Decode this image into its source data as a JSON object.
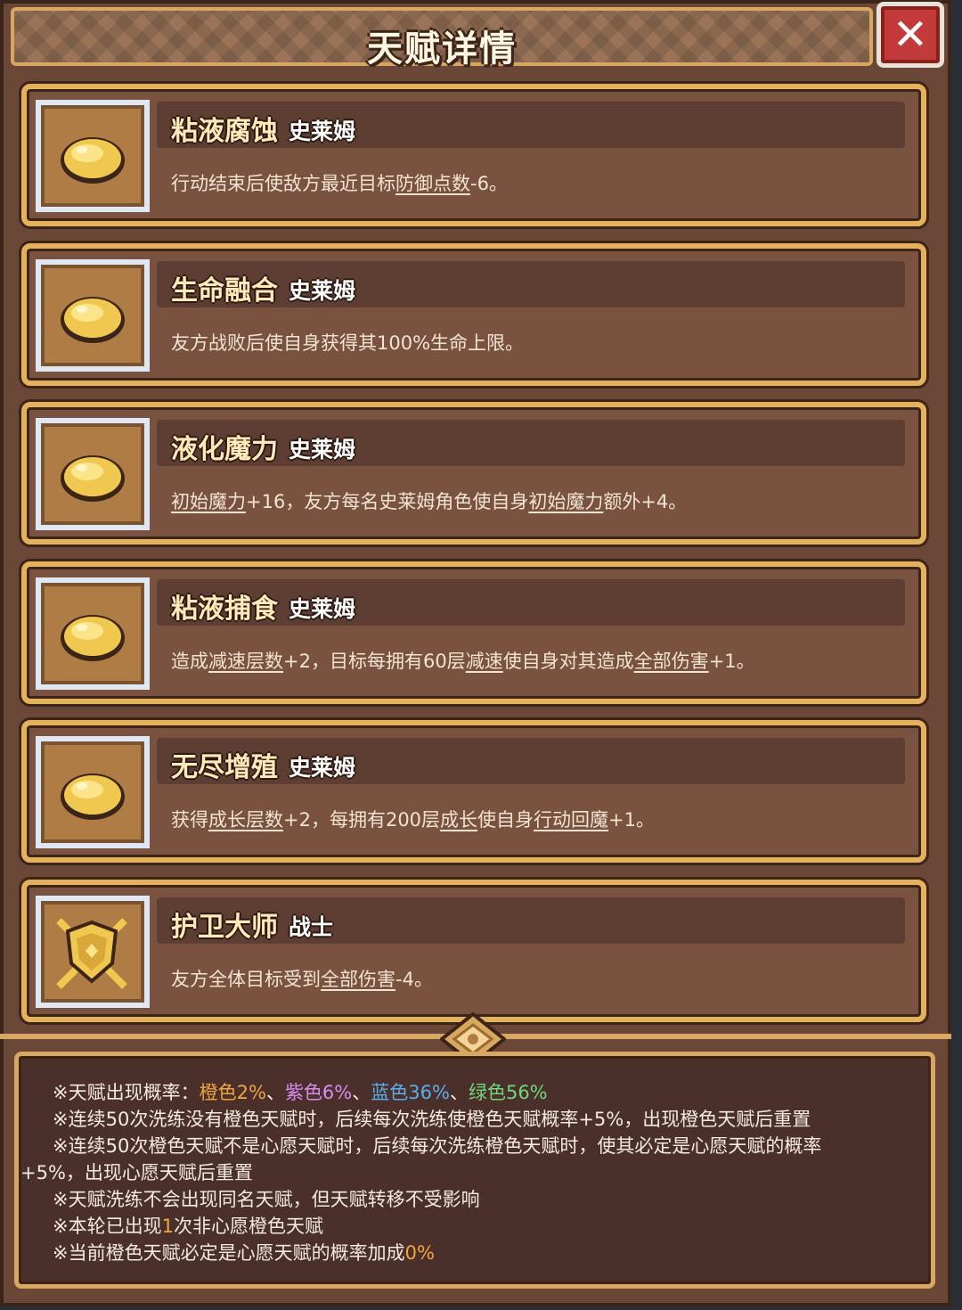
{
  "header": {
    "title": "天赋详情"
  },
  "talents": [
    {
      "name": "粘液腐蚀",
      "class": "史莱姆",
      "icon": "slime-icon",
      "desc": [
        {
          "t": "行动结束后使敌方最近目标"
        },
        {
          "t": "防御点数",
          "u": true
        },
        {
          "t": "-6。"
        }
      ]
    },
    {
      "name": "生命融合",
      "class": "史莱姆",
      "icon": "slime-icon",
      "desc": [
        {
          "t": "友方战败后使自身获得其100%生命上限。"
        }
      ]
    },
    {
      "name": "液化魔力",
      "class": "史莱姆",
      "icon": "slime-icon",
      "desc": [
        {
          "t": "初始魔力",
          "u": true
        },
        {
          "t": "+16，友方每名史莱姆角色使自身"
        },
        {
          "t": "初始魔力",
          "u": true
        },
        {
          "t": "额外+4。"
        }
      ]
    },
    {
      "name": "粘液捕食",
      "class": "史莱姆",
      "icon": "slime-icon",
      "desc": [
        {
          "t": "造成"
        },
        {
          "t": "减速层数",
          "u": true
        },
        {
          "t": "+2，目标每拥有60层"
        },
        {
          "t": "减速",
          "u": true
        },
        {
          "t": "使自身对其造成"
        },
        {
          "t": "全部伤害",
          "u": true
        },
        {
          "t": "+1。"
        }
      ]
    },
    {
      "name": "无尽增殖",
      "class": "史莱姆",
      "icon": "slime-icon",
      "desc": [
        {
          "t": "获得"
        },
        {
          "t": "成长层数",
          "u": true
        },
        {
          "t": "+2，每拥有200层"
        },
        {
          "t": "成长",
          "u": true
        },
        {
          "t": "使自身"
        },
        {
          "t": "行动回魔",
          "u": true
        },
        {
          "t": "+1。"
        }
      ]
    },
    {
      "name": "护卫大师",
      "class": "战士",
      "icon": "shield-icon",
      "desc": [
        {
          "t": "友方全体目标受到"
        },
        {
          "t": "全部伤害",
          "u": true
        },
        {
          "t": "-4。"
        }
      ]
    }
  ],
  "info": {
    "line1": {
      "prefix": "※天赋出现概率：",
      "orange": "橙色2%",
      "sep1": "、",
      "purple": "紫色6%",
      "sep2": "、",
      "blue": "蓝色36%",
      "sep3": "、",
      "green": "绿色56%"
    },
    "line2": "※连续50次洗练没有橙色天赋时，后续每次洗练使橙色天赋概率+5%，出现橙色天赋后重置",
    "line3": "※连续50次橙色天赋不是心愿天赋时，后续每次洗练橙色天赋时，使其必定是心愿天赋的概率",
    "line3b": "+5%，出现心愿天赋后重置",
    "line4": "※天赋洗练不会出现同名天赋，但天赋转移不受影响",
    "line5": {
      "prefix": "※本轮已出现",
      "count": "1",
      "suffix": "次非心愿橙色天赋"
    },
    "line6": {
      "prefix": "※当前橙色天赋必定是心愿天赋的概率加成",
      "value": "0%"
    }
  },
  "colors": {
    "orange": "#f0a640",
    "purple": "#d98cf0",
    "blue": "#58aef0",
    "green": "#6ed87a",
    "gold_border": "#e5b15d"
  }
}
